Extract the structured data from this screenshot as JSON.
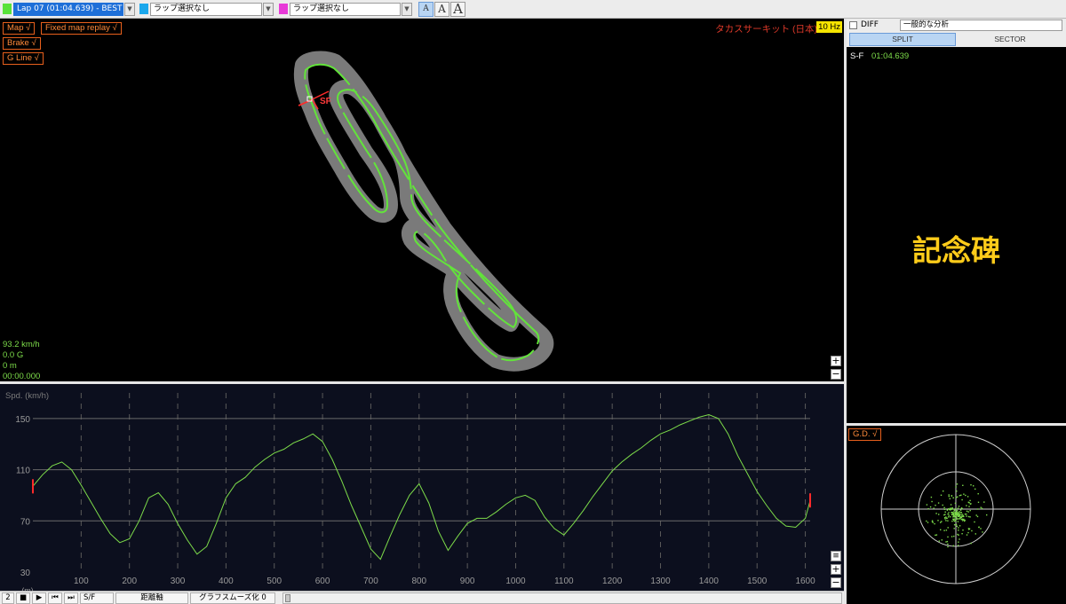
{
  "toolbar": {
    "lap1": "Lap 07 (01:04.639) - BEST",
    "lap2": "ラップ選択なし",
    "lap3": "ラップ選択なし",
    "font_small": "A",
    "font_medium": "A",
    "font_large": "A",
    "colors": {
      "lap1": "#59e23a",
      "lap2": "#1aa7ec",
      "lap3": "#e83ad8"
    }
  },
  "map": {
    "buttons": {
      "map": "Map √",
      "replay": "Fixed map replay √",
      "brake": "Brake √",
      "gline": "G Line √"
    },
    "circuit": "タカスサーキット (日本)",
    "hz": "10 Hz",
    "sf_label": "SF",
    "readouts": {
      "speed": "93.2 km/h",
      "g": "0.0 G",
      "dist": "0 m",
      "time": "00:00.000"
    },
    "zoom_in": "+",
    "zoom_out": "−"
  },
  "graph": {
    "ylabel": "Spd. (km/h)",
    "xunit": "(m)",
    "menu_icon": "≡",
    "zoom_in": "+",
    "zoom_out": "−"
  },
  "chart_data": {
    "type": "line",
    "ylabel": "Spd. (km/h)",
    "xlabel": "(m)",
    "xlim": [
      0,
      1610
    ],
    "ylim": [
      30,
      170
    ],
    "y_ticks": [
      30,
      70,
      110,
      150
    ],
    "x_ticks": [
      100,
      200,
      300,
      400,
      500,
      600,
      700,
      800,
      900,
      1000,
      1100,
      1200,
      1300,
      1400,
      1500,
      1600
    ],
    "grid": true,
    "series": [
      {
        "color": "#7ddc4a",
        "x": [
          0,
          20,
          40,
          60,
          80,
          100,
          120,
          140,
          160,
          180,
          200,
          220,
          240,
          260,
          280,
          300,
          320,
          340,
          360,
          380,
          400,
          420,
          440,
          460,
          480,
          500,
          520,
          540,
          560,
          580,
          600,
          620,
          640,
          660,
          680,
          700,
          720,
          740,
          760,
          780,
          800,
          820,
          840,
          860,
          880,
          900,
          920,
          940,
          960,
          980,
          1000,
          1020,
          1040,
          1060,
          1080,
          1100,
          1120,
          1140,
          1160,
          1180,
          1200,
          1220,
          1240,
          1260,
          1280,
          1300,
          1320,
          1340,
          1360,
          1380,
          1400,
          1420,
          1440,
          1460,
          1480,
          1500,
          1520,
          1540,
          1560,
          1580,
          1600,
          1610
        ],
        "values": [
          97,
          106,
          113,
          116,
          110,
          98,
          85,
          72,
          60,
          53,
          56,
          70,
          88,
          92,
          83,
          68,
          55,
          44,
          50,
          68,
          88,
          99,
          104,
          112,
          118,
          123,
          126,
          131,
          134,
          138,
          132,
          118,
          101,
          82,
          65,
          48,
          40,
          58,
          75,
          90,
          99,
          84,
          62,
          47,
          58,
          68,
          72,
          72,
          77,
          83,
          88,
          90,
          86,
          73,
          64,
          59,
          68,
          78,
          89,
          99,
          109,
          116,
          122,
          127,
          133,
          138,
          141,
          145,
          148,
          151,
          153,
          150,
          138,
          121,
          107,
          93,
          82,
          72,
          66,
          65,
          72,
          86
        ]
      }
    ]
  },
  "bottombar": {
    "step": "2",
    "stop": "■",
    "play": "▶",
    "prev": "⏮",
    "next": "⏭",
    "sf": "S/F",
    "axis": "距離軸",
    "smooth": "グラフスムーズ化 0"
  },
  "right": {
    "diff": "DIFF",
    "analysis": "一般的な分析",
    "tab_split": "SPLIT",
    "tab_sector": "SECTOR",
    "split_name": "S-F",
    "split_time": "01:04.639",
    "memorial": "記念碑",
    "gd": "G.D. √"
  }
}
